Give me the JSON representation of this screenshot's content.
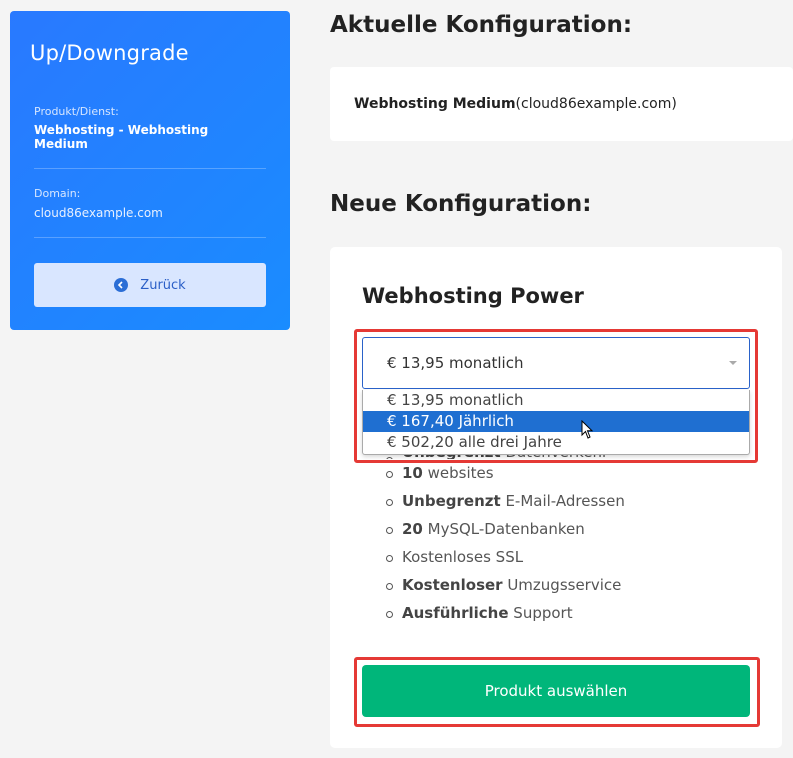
{
  "sidebar": {
    "title": "Up/Downgrade",
    "product_label": "Produkt/Dienst:",
    "product_value": "Webhosting - Webhosting Medium",
    "domain_label": "Domain:",
    "domain_value": "cloud86example.com",
    "back_button": "Zurück",
    "back_icon": "arrow-left-circle-icon"
  },
  "current": {
    "heading": "Aktuelle Konfiguration:",
    "product": "Webhosting Medium",
    "domain": "(cloud86example.com)"
  },
  "new_config": {
    "heading": "Neue Konfiguration:",
    "plan_name": "Webhosting Power",
    "billing_select": {
      "selected": "€ 13,95 monatlich",
      "options": [
        "€ 13,95 monatlich",
        "€ 167,40 Jährlich",
        "€ 502,20 alle drei Jahre"
      ],
      "highlighted_index": 1
    },
    "features": [
      {
        "bold": "Unbegrenzt",
        "text": " Datenverkehr"
      },
      {
        "bold": "10",
        "text": " websites"
      },
      {
        "bold": "Unbegrenzt",
        "text": " E-Mail-Adressen"
      },
      {
        "bold": "20",
        "text": " MySQL-Datenbanken"
      },
      {
        "bold": "",
        "text": "Kostenloses SSL"
      },
      {
        "bold": "Kostenloser",
        "text": " Umzugsservice"
      },
      {
        "bold": "Ausführliche",
        "text": " Support"
      }
    ],
    "select_button": "Produkt auswählen"
  },
  "colors": {
    "sidebar_bg": "#2979ff",
    "accent_green": "#00b67a",
    "highlight_red": "#e53935",
    "dropdown_selected": "#1f6fd1"
  }
}
